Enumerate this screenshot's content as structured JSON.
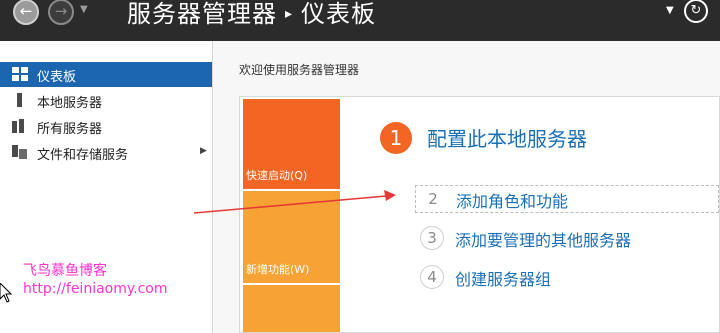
{
  "titlebar": {
    "back_glyph": "←",
    "forward_glyph": "→",
    "dropdown_glyph": "▼",
    "app_title": "服务器管理器",
    "separator": "▸",
    "page_title": "仪表板",
    "menu_caret": "▼",
    "refresh_glyph": "↻"
  },
  "sidebar": {
    "items": [
      {
        "label": "仪表板",
        "icon": "dashboard-icon",
        "active": true
      },
      {
        "label": "本地服务器",
        "icon": "server-icon",
        "active": false
      },
      {
        "label": "所有服务器",
        "icon": "servers-icon",
        "active": false
      },
      {
        "label": "文件和存储服务",
        "icon": "storage-icon",
        "active": false,
        "has_submenu": true
      }
    ],
    "submenu_arrow": "▶"
  },
  "main": {
    "welcome": "欢迎使用服务器管理器",
    "tiles": [
      {
        "label": "快速启动(Q)",
        "color": "#f26522"
      },
      {
        "label": "新增功能(W)",
        "color": "#f7a234"
      }
    ],
    "step1": {
      "number": "1",
      "label": "配置此本地服务器"
    },
    "steps": [
      {
        "number": "2",
        "label": "添加角色和功能"
      },
      {
        "number": "3",
        "label": "添加要管理的其他服务器"
      },
      {
        "number": "4",
        "label": "创建服务器组"
      }
    ]
  },
  "watermark": {
    "title": "飞鸟慕鱼博客",
    "url": "http://feiniaomy.com"
  },
  "colors": {
    "titlebar_bg": "#2b2b2b",
    "active_item": "#1c66b0",
    "accent_orange": "#f26522",
    "tile_amber": "#f7a234",
    "link_blue": "#1b6fb7",
    "annotation_red": "#e53935",
    "watermark_magenta": "#ff33cc"
  }
}
